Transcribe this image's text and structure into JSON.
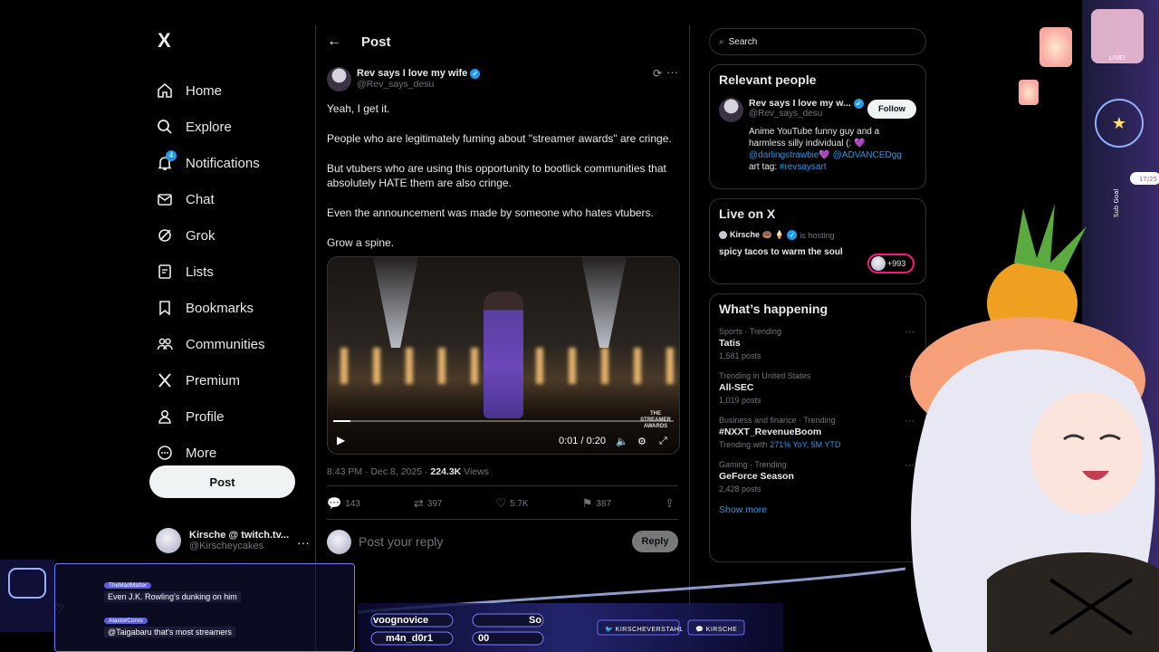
{
  "nav": {
    "logo": "X",
    "items": [
      {
        "label": "Home",
        "icon": "home-icon"
      },
      {
        "label": "Explore",
        "icon": "search-icon"
      },
      {
        "label": "Notifications",
        "icon": "bell-icon",
        "badge": "4"
      },
      {
        "label": "Chat",
        "icon": "envelope-icon"
      },
      {
        "label": "Grok",
        "icon": "grok-icon"
      },
      {
        "label": "Lists",
        "icon": "list-icon"
      },
      {
        "label": "Bookmarks",
        "icon": "bookmark-icon"
      },
      {
        "label": "Communities",
        "icon": "people-icon"
      },
      {
        "label": "Premium",
        "icon": "x-logo-icon"
      },
      {
        "label": "Profile",
        "icon": "person-icon"
      },
      {
        "label": "More",
        "icon": "more-circle-icon"
      }
    ],
    "post_label": "Post",
    "account": {
      "name": "Kirsche @ twitch.tv...",
      "handle": "@Kirscheycakes",
      "more": "···"
    }
  },
  "post": {
    "header_title": "Post",
    "back": "←",
    "author": {
      "name": "Rev says I love my wife",
      "handle": "@Rev_says_desu",
      "verified": "✓"
    },
    "paragraphs": [
      "Yeah, I get it.",
      "People who are legitimately fuming about \"streamer awards\" are cringe.",
      "But vtubers who are using this opportunity to bootlick communities that absolutely HATE them are also cringe.",
      "Even the announcement was made by someone who hates vtubers.",
      "Grow a spine."
    ],
    "video": {
      "time": "0:01 / 0:20",
      "progress": 0.05,
      "brand": "THE STREAMER AWARDS",
      "play": "▶"
    },
    "meta": {
      "time": "8:43 PM · Dec 8, 2025 · ",
      "views": "224.3K",
      "views_label": " Views"
    },
    "actions": {
      "replies": "143",
      "reposts": "397",
      "likes": "5.7K",
      "bookmarks": "387"
    },
    "reply_placeholder": "Post your reply",
    "reply_button": "Reply"
  },
  "right": {
    "search_placeholder": "Search",
    "relevant": {
      "title": "Relevant people",
      "name": "Rev says I love my w...",
      "handle": "@Rev_says_desu",
      "follow": "Follow",
      "bio_1": "Anime YouTube funny guy and a harmless silly individual (: 💜",
      "bio_link_1": "@darlingstrawbie",
      "bio_mid": "💜 ",
      "bio_link_2": "@ADVANCEDgg",
      "bio_3": "art tag: ",
      "bio_link_3": "#revsaysart"
    },
    "live": {
      "title": "Live on X",
      "host": "Kirsche 🍩 🍦",
      "hosting": "is hosting",
      "stream_title": "spicy tacos to warm the soul",
      "count": "+993"
    },
    "happening": {
      "title": "What’s happening",
      "trends": [
        {
          "context": "Sports · Trending",
          "title": "Tatis",
          "sub": "1,581 posts"
        },
        {
          "context": "Trending in United States",
          "title": "All-SEC",
          "sub": "1,019 posts"
        },
        {
          "context": "Business and finance · Trending",
          "title": "#NXXT_RevenueBoom",
          "sub_prefix": "Trending with ",
          "sub_link": "271% YoY, 5M YTD"
        },
        {
          "context": "Gaming · Trending",
          "title": "GeForce Season",
          "sub": "2,428 posts"
        }
      ],
      "show_more": "Show more"
    }
  },
  "overlay": {
    "chat": [
      {
        "user": "TheMadMatter",
        "msg": "Even J.K. Rowling's dunking on him"
      },
      {
        "user": "AlastorCorvo",
        "msg": "@Taigabaru that's most streamers"
      }
    ],
    "hud_1": "voognovice",
    "hud_2": "m4n_d0r1",
    "hud_3": "So",
    "hud_4": "00",
    "social_1": "KIRSCHEVERSTAHL",
    "social_2": "KIRSCHE",
    "live_sign": "LIVE!",
    "goal_text": "17/25",
    "goal_label": "Sub Goal"
  },
  "colors": {
    "accent": "#1d9bf0",
    "bg": "#000000",
    "border": "#2f3336",
    "muted": "#71767b",
    "live": "#f91880"
  }
}
